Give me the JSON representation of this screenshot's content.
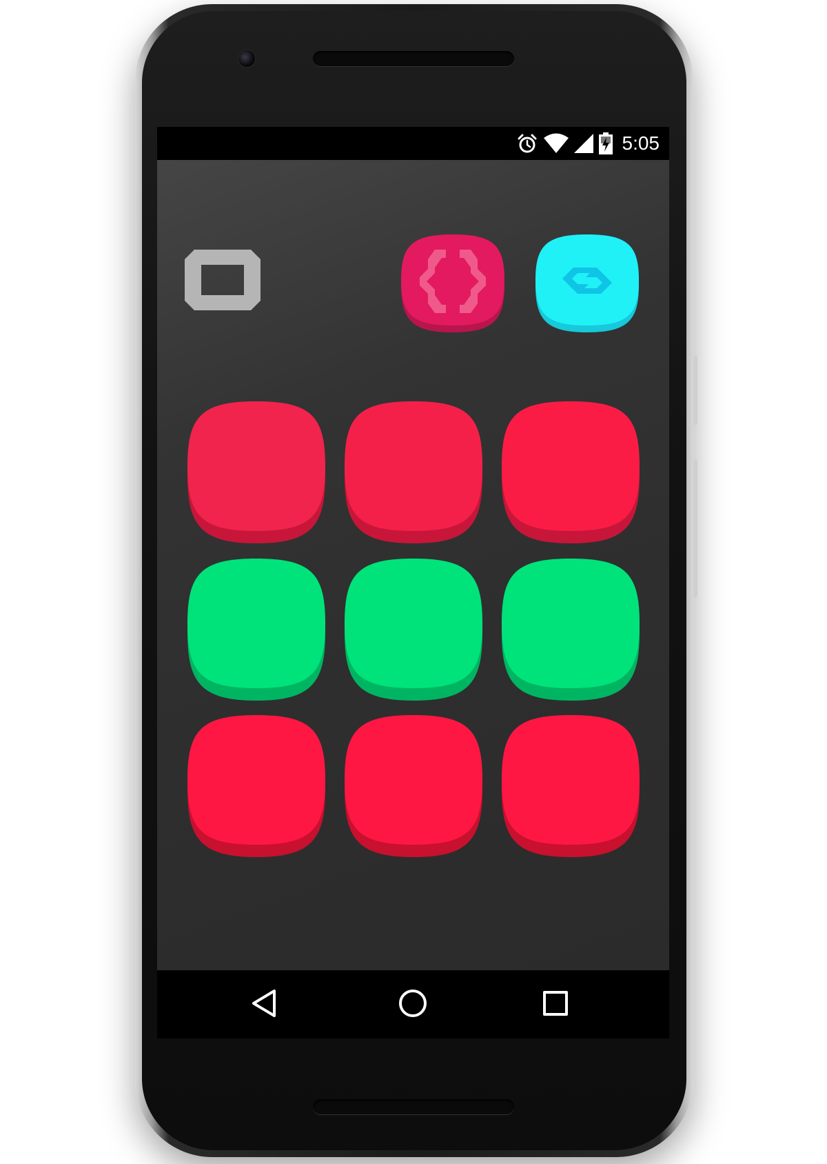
{
  "status_bar": {
    "time": "5:05",
    "icons": [
      "alarm-icon",
      "wifi-icon",
      "cell-signal-icon",
      "battery-charging-icon"
    ]
  },
  "top_icons": [
    {
      "name": "square-outline-icon",
      "color": "#b5b5b5"
    },
    {
      "name": "code-braces-icon",
      "color": "#e31a5f",
      "glyph_color": "#f05a8a"
    },
    {
      "name": "link-chain-icon",
      "color": "#1ff1f7",
      "glyph_color": "#10c4e6"
    }
  ],
  "grid_icons": {
    "rows": [
      {
        "color": "#f0244c",
        "side_color": "#c7163a",
        "count": 3
      },
      {
        "color": "#00e37a",
        "side_color": "#00b562",
        "count": 3
      },
      {
        "color": "#ff1744",
        "side_color": "#c8102f",
        "count": 3
      }
    ]
  },
  "nav_bar": {
    "buttons": [
      "back-triangle-icon",
      "home-circle-icon",
      "recents-square-icon"
    ]
  },
  "colors": {
    "launcher_background": "#333333",
    "phone_body": "#1b1b1b"
  }
}
